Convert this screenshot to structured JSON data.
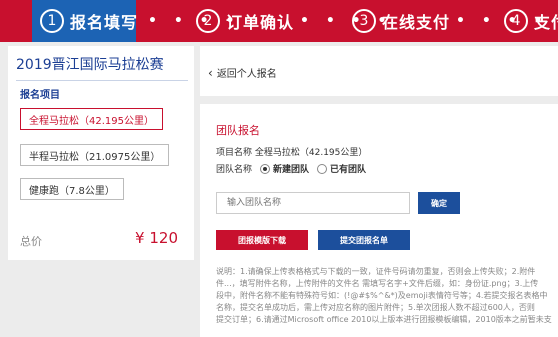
{
  "steps": [
    {
      "num": "1",
      "label": "报名填写"
    },
    {
      "num": "2",
      "label": "订单确认"
    },
    {
      "num": "3",
      "label": "在线支付"
    },
    {
      "num": "4",
      "label": "支付"
    }
  ],
  "step_dots": "• • • •",
  "race": {
    "title": "2019晋江国际马拉松赛",
    "section_label": "报名项目",
    "options": [
      {
        "label": "全程马拉松（42.195公里）",
        "selected": true
      },
      {
        "label": "半程马拉松（21.0975公里）",
        "selected": false
      },
      {
        "label": "健康跑（7.8公里）",
        "selected": false
      }
    ],
    "total_label": "总价",
    "total_price": "¥ 120"
  },
  "back_link": "返回个人报名",
  "team_form": {
    "title": "团队报名",
    "project_label": "项目名称",
    "project_value": "全程马拉松（42.195公里）",
    "team_label": "团队名称",
    "radio_new": "新建团队",
    "radio_existing": "已有团队",
    "input_placeholder": "输入团队名称",
    "confirm_label": "确定",
    "download_label": "团报模版下载",
    "submit_label": "提交团报名单"
  },
  "notes": [
    "说明：1.请确保上传表格格式与下载的一致，证件号码请勿重复，否则会上传失败；2.附件",
    "件...，填写附件名称，上传附件的文件名 需填写名字+文件后缀，如：身份证.png；3.上传",
    "段中，附件名称不能有特殊符号如：(!@#$%^&*)及emoji表情符号等；4.若提交报名表格中",
    "名称，提交名单成功后，需上传对应名称的图片附件；5.单次团报人数不超过600人，否则",
    "提交订单；6.请通过Microsoft office 2010以上版本进行团报模板编辑，2010版本之前暂未支"
  ],
  "colors": {
    "brand_red": "#c8102e",
    "brand_blue": "#1c4f9c"
  }
}
